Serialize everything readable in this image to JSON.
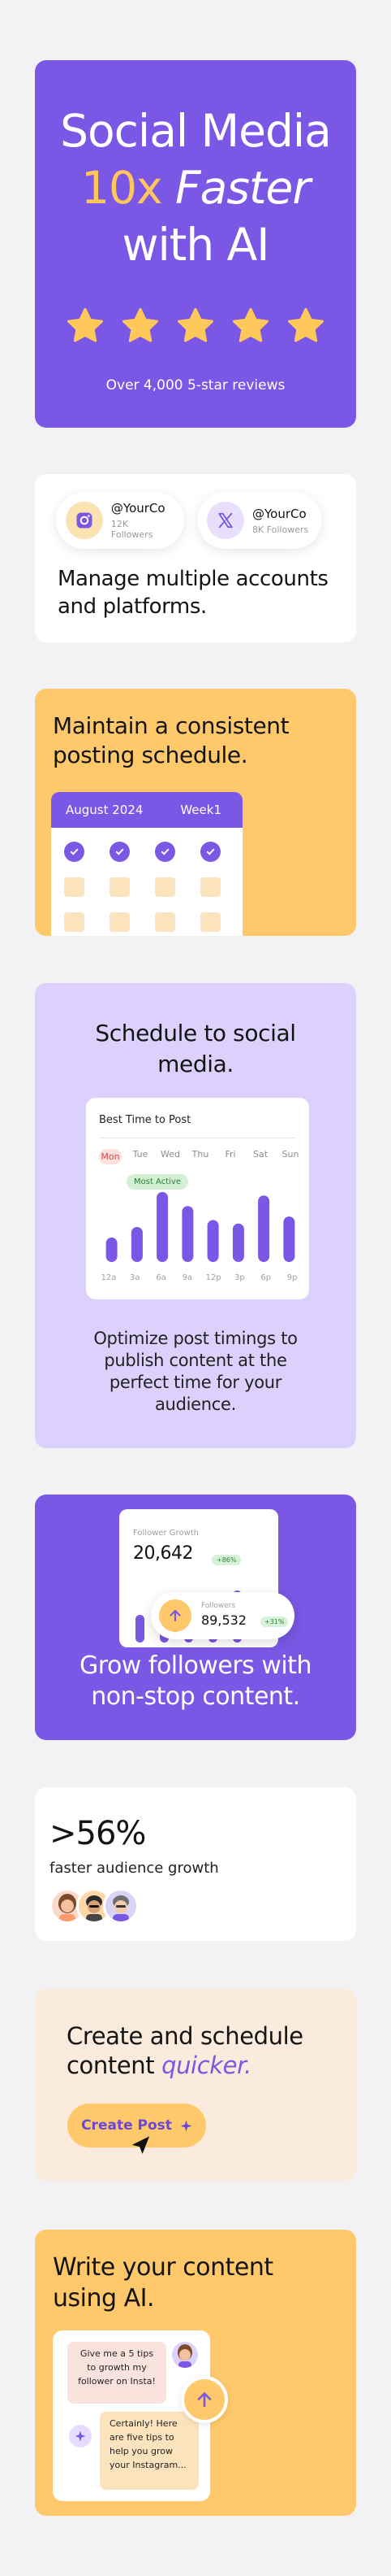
{
  "hero": {
    "line1": "Social Media",
    "line2_accent": "10x",
    "line2_italic": "Faster",
    "line3": "with AI",
    "star_rating": 5,
    "reviews": "Over 4,000 5-star reviews"
  },
  "accounts": {
    "items": [
      {
        "icon": "instagram-icon",
        "handle": "@YourCo",
        "followers": "12K Followers"
      },
      {
        "icon": "x-icon",
        "handle": "@YourCo",
        "followers": "8K Followers"
      }
    ],
    "text": "Manage multiple accounts and platforms."
  },
  "schedule": {
    "text": "Maintain a consistent posting schedule.",
    "calendar_month": "August 2024",
    "calendar_week": "Week1"
  },
  "schedule_social": {
    "title": "Schedule to social media.",
    "chart_title": "Best Time to Post",
    "days": [
      "Mon",
      "Tue",
      "Wed",
      "Thu",
      "Fri",
      "Sat",
      "Sun"
    ],
    "active_day": "Mon",
    "most_active_label": "Most Active",
    "times": [
      "12a",
      "3a",
      "6a",
      "9a",
      "12p",
      "3p",
      "6p",
      "9p"
    ],
    "subtitle": "Optimize post timings to publish content at the perfect time for your audience."
  },
  "growth": {
    "follower_growth_label": "Follower Growth",
    "follower_growth_value": "20,642",
    "follower_growth_badge": "+86%",
    "followers_label": "Followers",
    "followers_value": "89,532",
    "followers_badge": "+31%",
    "text": "Grow followers with non-stop content."
  },
  "stat": {
    "value": ">56%",
    "label": "faster audience growth"
  },
  "create": {
    "text": "Create and schedule content",
    "accent": "quicker.",
    "button": "Create Post"
  },
  "ai": {
    "text": "Write your content using AI.",
    "user_message": "Give me a 5 tips to growth my follower on Insta!",
    "ai_reply": "Certainly! Here are five tips to help you grow your Instagram..."
  },
  "colors": {
    "purple": "#7a57e4",
    "yellow": "#ffc96b",
    "lavender": "#dcd1fc",
    "cream": "#fbebdd"
  },
  "chart_data": {
    "type": "bar",
    "title": "Best Time to Post",
    "categories": [
      "12a",
      "3a",
      "6a",
      "9a",
      "12p",
      "3p",
      "6p",
      "9p"
    ],
    "values": [
      35,
      50,
      100,
      80,
      60,
      55,
      95,
      65
    ],
    "ylim": [
      0,
      100
    ],
    "grid": false
  }
}
